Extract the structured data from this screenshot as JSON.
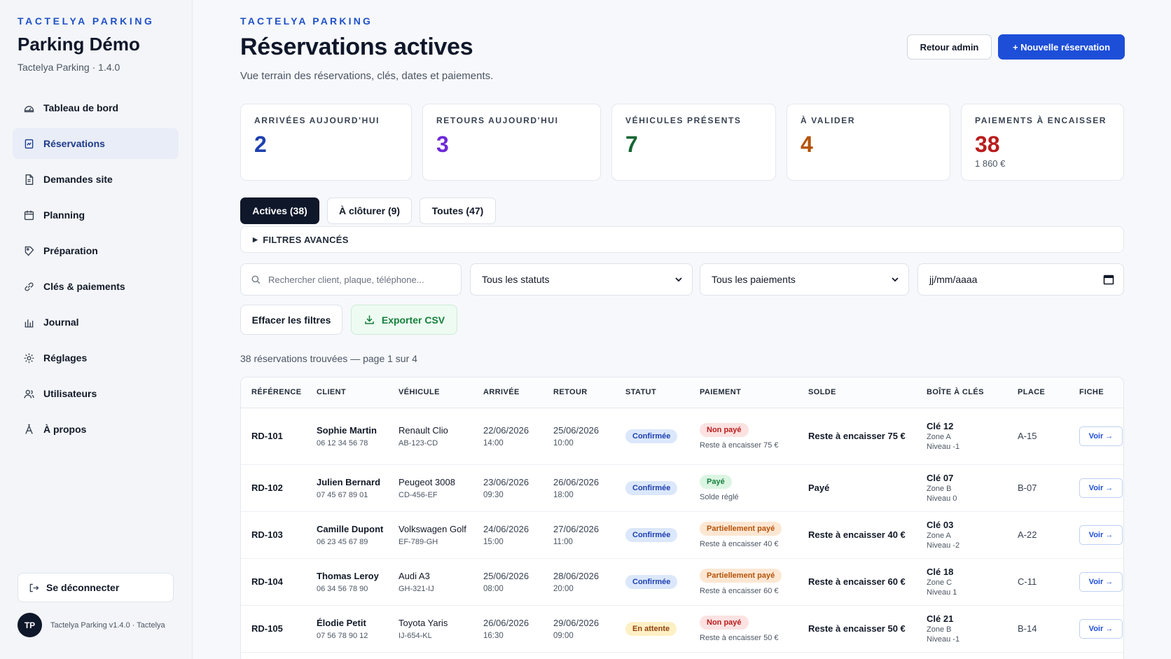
{
  "sidebar": {
    "eyebrow": "TACTELYA PARKING",
    "title": "Parking Démo",
    "subtitle": "Tactelya Parking · 1.4.0",
    "items": [
      {
        "label": "Tableau de bord",
        "icon": "dashboard-icon"
      },
      {
        "label": "Réservations",
        "icon": "reservations-icon",
        "active": true
      },
      {
        "label": "Demandes site",
        "icon": "document-icon"
      },
      {
        "label": "Planning",
        "icon": "calendar-icon"
      },
      {
        "label": "Préparation",
        "icon": "tag-icon"
      },
      {
        "label": "Clés & paiements",
        "icon": "link-icon"
      },
      {
        "label": "Journal",
        "icon": "chart-icon"
      },
      {
        "label": "Réglages",
        "icon": "gear-icon"
      },
      {
        "label": "Utilisateurs",
        "icon": "users-icon"
      },
      {
        "label": "À propos",
        "icon": "about-icon"
      }
    ],
    "logout": "Se déconnecter",
    "avatar_initials": "TP",
    "footer_text": "Tactelya Parking v1.4.0 · Tactelya"
  },
  "header": {
    "eyebrow": "TACTELYA PARKING",
    "title": "Réservations actives",
    "subtitle": "Vue terrain des réservations, clés, dates et paiements.",
    "btn_admin": "Retour admin",
    "btn_new": "+ Nouvelle réservation"
  },
  "kpis": [
    {
      "label": "ARRIVÉES AUJOURD'HUI",
      "value": "2",
      "color": "#1e40af"
    },
    {
      "label": "RETOURS AUJOURD'HUI",
      "value": "3",
      "color": "#6d28d9"
    },
    {
      "label": "VÉHICULES PRÉSENTS",
      "value": "7",
      "color": "#166534"
    },
    {
      "label": "À VALIDER",
      "value": "4",
      "color": "#b45309"
    },
    {
      "label": "PAIEMENTS À ENCAISSER",
      "value": "38",
      "sub": "1 860 €",
      "color": "#b91c1c"
    }
  ],
  "tabs": [
    "Actives (38)",
    "À clôturer (9)",
    "Toutes (47)"
  ],
  "filters": {
    "advanced": "FILTRES AVANCÉS",
    "search_placeholder": "Rechercher client, plaque, téléphone...",
    "status_value": "Tous les statuts",
    "payment_value": "Tous les paiements",
    "date_placeholder": "jj/mm/aaaa",
    "clear": "Effacer les filtres",
    "export": "Exporter CSV"
  },
  "results": {
    "count_text": "38 réservations trouvées — page 1 sur 4"
  },
  "table": {
    "columns": [
      "RÉFÉRENCE",
      "CLIENT",
      "VÉHICULE",
      "ARRIVÉE",
      "RETOUR",
      "STATUT",
      "PAIEMENT",
      "SOLDE",
      "BOÎTE À CLÉS",
      "PLACE",
      "FICHE"
    ],
    "rows": [
      {
        "ref": "RD-101",
        "client": "Sophie Martin",
        "phone": "06 12 34 56 78",
        "vehicle": "Renault Clio",
        "plate": "AB-123-CD",
        "arr_date": "22/06/2026",
        "arr_time": "14:00",
        "ret_date": "25/06/2026",
        "ret_time": "10:00",
        "status": "Confirmée",
        "payment": "Non payé",
        "payment_sub": "Reste à encaisser 75 €",
        "solde": "Reste à encaisser 75 €",
        "key": "Clé 12",
        "zone": "Zone A",
        "level": "Niveau -1",
        "place": "A-15",
        "action": "Voir →"
      },
      {
        "ref": "RD-102",
        "client": "Julien Bernard",
        "phone": "07 45 67 89 01",
        "vehicle": "Peugeot 3008",
        "plate": "CD-456-EF",
        "arr_date": "23/06/2026",
        "arr_time": "09:30",
        "ret_date": "26/06/2026",
        "ret_time": "18:00",
        "status": "Confirmée",
        "payment": "Payé",
        "payment_sub": "Solde réglé",
        "solde": "Payé",
        "key": "Clé 07",
        "zone": "Zone B",
        "level": "Niveau 0",
        "place": "B-07",
        "action": "Voir →"
      },
      {
        "ref": "RD-103",
        "client": "Camille Dupont",
        "phone": "06 23 45 67 89",
        "vehicle": "Volkswagen Golf",
        "plate": "EF-789-GH",
        "arr_date": "24/06/2026",
        "arr_time": "15:00",
        "ret_date": "27/06/2026",
        "ret_time": "11:00",
        "status": "Confirmée",
        "payment": "Partiellement payé",
        "payment_sub": "Reste à encaisser 40 €",
        "solde": "Reste à encaisser 40 €",
        "key": "Clé 03",
        "zone": "Zone A",
        "level": "Niveau -2",
        "place": "A-22",
        "action": "Voir →"
      },
      {
        "ref": "RD-104",
        "client": "Thomas Leroy",
        "phone": "06 34 56 78 90",
        "vehicle": "Audi A3",
        "plate": "GH-321-IJ",
        "arr_date": "25/06/2026",
        "arr_time": "08:00",
        "ret_date": "28/06/2026",
        "ret_time": "20:00",
        "status": "Confirmée",
        "payment": "Partiellement payé",
        "payment_sub": "Reste à encaisser 60 €",
        "solde": "Reste à encaisser 60 €",
        "key": "Clé 18",
        "zone": "Zone C",
        "level": "Niveau 1",
        "place": "C-11",
        "action": "Voir →"
      },
      {
        "ref": "RD-105",
        "client": "Élodie Petit",
        "phone": "07 56 78 90 12",
        "vehicle": "Toyota Yaris",
        "plate": "IJ-654-KL",
        "arr_date": "26/06/2026",
        "arr_time": "16:30",
        "ret_date": "29/06/2026",
        "ret_time": "09:00",
        "status": "En attente",
        "payment": "Non payé",
        "payment_sub": "Reste à encaisser 50 €",
        "solde": "Reste à encaisser 50 €",
        "key": "Clé 21",
        "zone": "Zone B",
        "level": "Niveau -1",
        "place": "B-14",
        "action": "Voir →"
      }
    ]
  },
  "colors": {
    "accent": "#1d4ed8",
    "status_confirmed_bg": "#dbe7fb",
    "status_confirmed_fg": "#1e40af",
    "status_pending_bg": "#fdf0c4",
    "status_pending_fg": "#92400e",
    "pay_unpaid_bg": "#fde2e2",
    "pay_unpaid_fg": "#b91c1c",
    "pay_paid_bg": "#dcf5e3",
    "pay_paid_fg": "#15803d",
    "pay_partial_bg": "#fde7d3",
    "pay_partial_fg": "#b45309"
  }
}
